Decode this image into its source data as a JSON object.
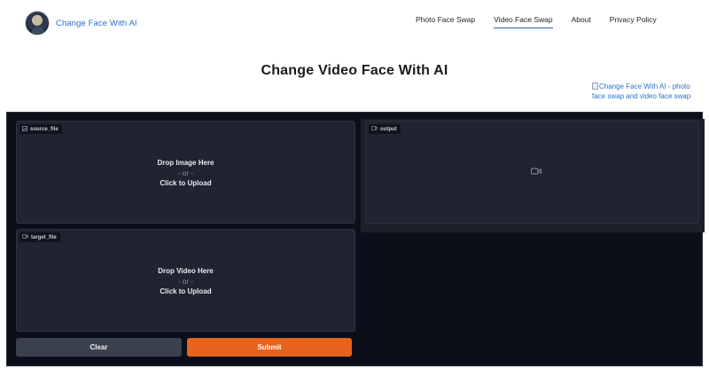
{
  "header": {
    "brand": "Change Face With AI",
    "nav": [
      {
        "label": "Photo Face Swap",
        "active": false
      },
      {
        "label": "Video Face Swap",
        "active": true
      },
      {
        "label": "About",
        "active": false
      },
      {
        "label": "Privacy Policy",
        "active": false
      }
    ]
  },
  "main": {
    "title": "Change Video Face With AI",
    "broken_image_alt": "Change Face With AI - photo face swap and video face swap"
  },
  "app": {
    "source": {
      "label": "source_file",
      "icon": "image-icon",
      "drop": "Drop Image Here",
      "or": "- or -",
      "click": "Click to Upload"
    },
    "target": {
      "label": "target_file",
      "icon": "video-icon",
      "drop": "Drop Video Here",
      "or": "- or -",
      "click": "Click to Upload"
    },
    "output": {
      "label": "output",
      "icon": "video-icon"
    },
    "buttons": {
      "clear": "Clear",
      "submit": "Submit"
    }
  },
  "colors": {
    "accent": "#e8631b",
    "link": "#2c73c9",
    "app_bg": "#0b0f19"
  }
}
